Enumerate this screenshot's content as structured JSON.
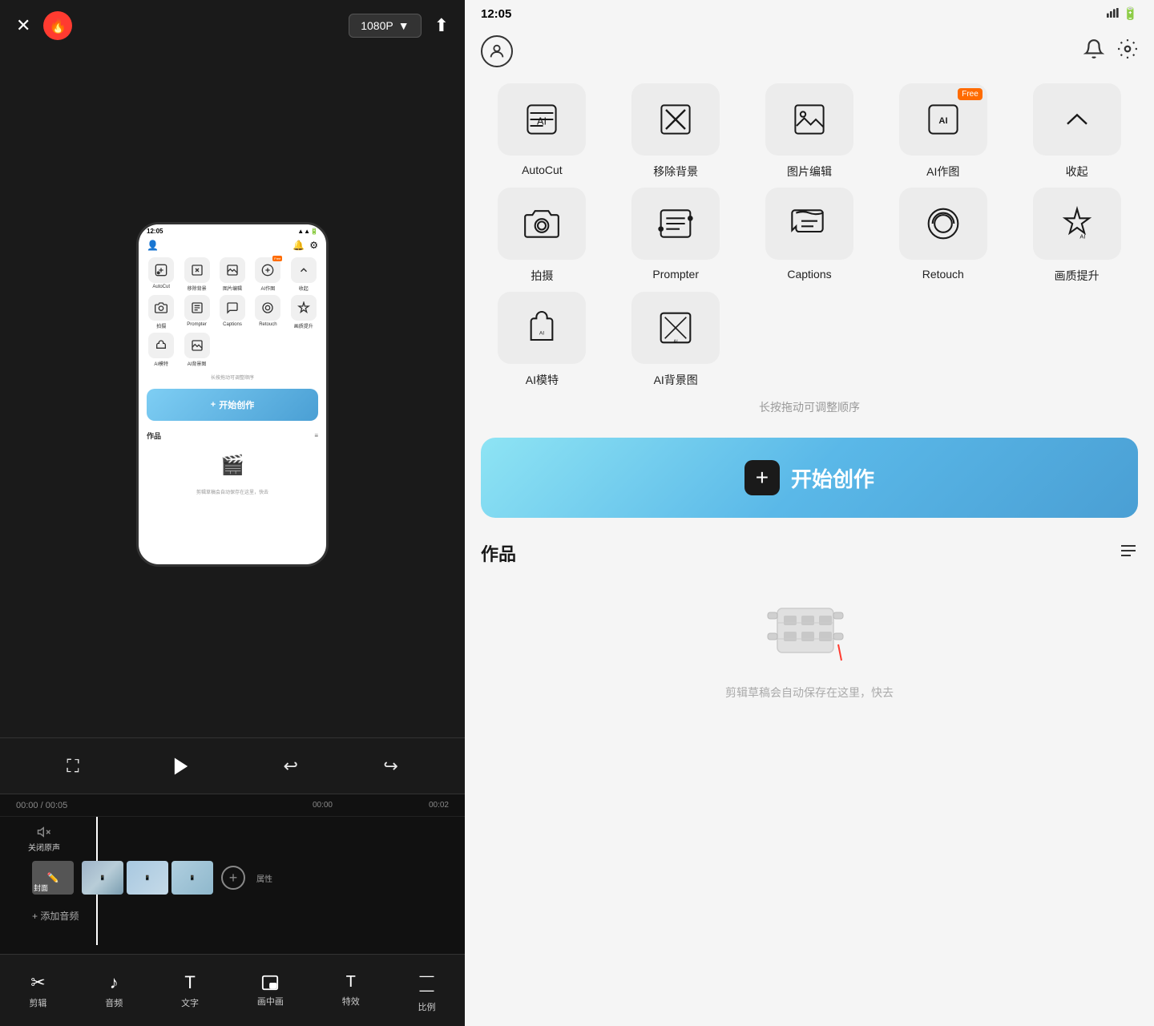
{
  "left": {
    "close_label": "✕",
    "brand_icon": "🔥",
    "resolution": "1080P",
    "resolution_arrow": "▼",
    "export_icon": "⬆",
    "phone": {
      "status_time": "12:05",
      "status_icons": "📶",
      "grid_items": [
        {
          "label": "AutoCut",
          "icon": "✂️",
          "free": false
        },
        {
          "label": "移除背景",
          "icon": "⬛",
          "free": false
        },
        {
          "label": "图片编辑",
          "icon": "🖼",
          "free": false
        },
        {
          "label": "AI作图",
          "icon": "🎨",
          "free": true
        },
        {
          "label": "收起",
          "icon": "∧",
          "free": false
        },
        {
          "label": "拍摄",
          "icon": "📷",
          "free": false
        },
        {
          "label": "Prompter",
          "icon": "📋",
          "free": false
        },
        {
          "label": "Captions",
          "icon": "💬",
          "free": false
        },
        {
          "label": "Retouch",
          "icon": "🔄",
          "free": false
        },
        {
          "label": "画质提升",
          "icon": "⬆",
          "free": false
        },
        {
          "label": "AI模特",
          "icon": "👗",
          "free": false
        },
        {
          "label": "AI背景图",
          "icon": "🖼",
          "free": false
        }
      ],
      "drag_hint": "长按拖动可调整顺序",
      "create_btn": "开始创作",
      "create_plus": "+",
      "works_label": "作品",
      "film_icon": "🎬",
      "autosave": "剪辑草稿会自动保存在这里，快去"
    },
    "controls": {
      "fullscreen": "⛶",
      "play": "▶",
      "undo": "↩",
      "redo": "↪"
    },
    "timeline": {
      "current_time": "00:00",
      "total_time": "00:05",
      "mark_00": "00:00",
      "mark_02": "00:02",
      "close_audio_label": "关闭原声",
      "cover_label": "封面",
      "add_audio": "+ 添加音频",
      "attr_label": "属性"
    },
    "toolbar": {
      "items": [
        {
          "label": "剪辑",
          "icon": "✂"
        },
        {
          "label": "音频",
          "icon": "♪"
        },
        {
          "label": "文字",
          "icon": "T"
        },
        {
          "label": "画中画",
          "icon": "⬜"
        },
        {
          "label": "特效",
          "icon": "T"
        },
        {
          "label": "比例",
          "icon": "—"
        }
      ]
    }
  },
  "right": {
    "status_bar": {
      "time": "12:05",
      "signal_icons": "▲▲ 🔋"
    },
    "user_icon": "👤",
    "notification_icon": "🔔",
    "settings_icon": "⚙",
    "feature_rows": [
      [
        {
          "label": "AutoCut",
          "icon": "✂",
          "free": false,
          "type": "icon"
        },
        {
          "label": "移除背景",
          "icon": "⬛",
          "free": false,
          "type": "icon"
        },
        {
          "label": "图片编辑",
          "icon": "🖼",
          "free": false,
          "type": "icon"
        },
        {
          "label": "AI作图",
          "icon": "🎨",
          "free": true,
          "type": "icon"
        },
        {
          "label": "收起",
          "icon": "∧",
          "free": false,
          "type": "collapse"
        }
      ],
      [
        {
          "label": "拍摄",
          "icon": "📷",
          "free": false,
          "type": "icon"
        },
        {
          "label": "Prompter",
          "icon": "📋",
          "free": false,
          "type": "icon"
        },
        {
          "label": "Captions",
          "icon": "💬",
          "free": false,
          "type": "icon"
        },
        {
          "label": "Retouch",
          "icon": "🔄",
          "free": false,
          "type": "icon"
        },
        {
          "label": "画质提升",
          "icon": "⬆",
          "free": false,
          "type": "icon"
        }
      ],
      [
        {
          "label": "AI模特",
          "icon": "👗",
          "free": false,
          "type": "icon"
        },
        {
          "label": "AI背景图",
          "icon": "🖼",
          "free": false,
          "type": "icon"
        }
      ]
    ],
    "drag_hint": "长按拖动可调整顺序",
    "create_btn": {
      "plus_label": "+",
      "text": "开始创作"
    },
    "works": {
      "title": "作品",
      "menu_icon": "≡"
    },
    "empty": {
      "film_icon": "🎬",
      "autosave_text": "剪辑草稿会自动保存在这里，快去"
    }
  }
}
